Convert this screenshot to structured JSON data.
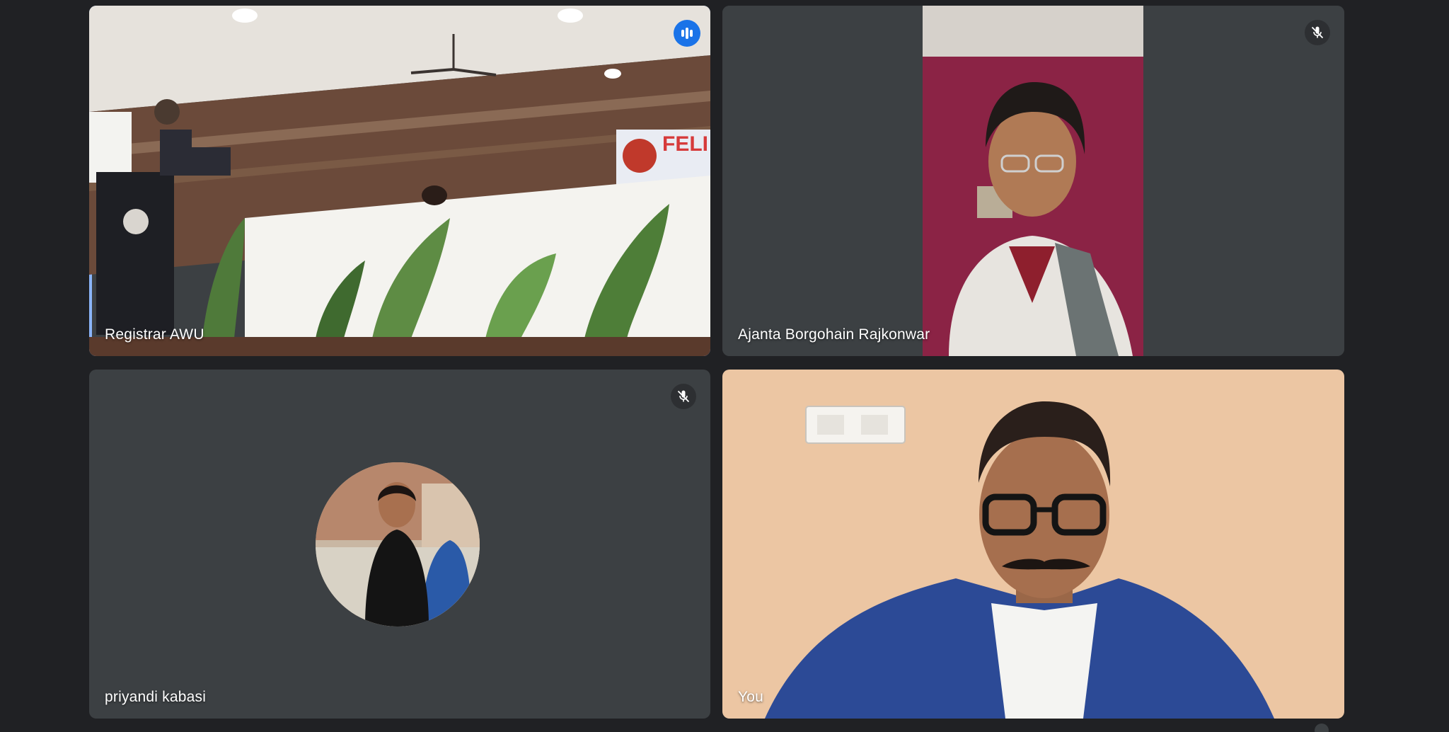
{
  "participants": [
    {
      "name": "Registrar AWU",
      "status": "speaking"
    },
    {
      "name": "Ajanta Borgohain Rajkonwar",
      "status": "muted"
    },
    {
      "name": "priyandi kabasi",
      "status": "muted"
    },
    {
      "name": "You",
      "status": "self"
    }
  ],
  "colors": {
    "background": "#202124",
    "tile": "#3c4043",
    "active_border": "#8ab4f8",
    "speaking_badge": "#1a73e8"
  },
  "icons": {
    "speaking": "audio-level-icon",
    "muted": "mic-off-icon"
  }
}
